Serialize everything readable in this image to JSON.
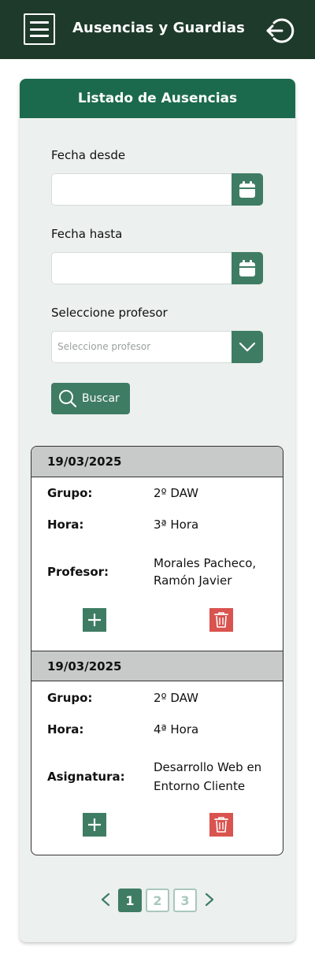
{
  "header": {
    "title": "Ausencias y Guardias",
    "menu_icon": "hamburger-menu-icon",
    "logout_icon": "logout-icon"
  },
  "panel": {
    "title": "Listado de Ausencias",
    "fecha_desde": {
      "label": "Fecha desde",
      "value": ""
    },
    "fecha_hasta": {
      "label": "Fecha hasta",
      "value": ""
    },
    "profesor": {
      "label": "Seleccione profesor",
      "placeholder": "Seleccione profesor"
    },
    "search_label": "Buscar"
  },
  "records": [
    {
      "date": "19/03/2025",
      "grupo_label": "Grupo:",
      "grupo": "2º DAW",
      "hora_label": "Hora:",
      "hora": "3ª Hora",
      "extra_label": "Profesor:",
      "extra_line1": "Morales Pacheco,",
      "extra_line2": "Ramón Javier"
    },
    {
      "date": "19/03/2025",
      "grupo_label": "Grupo:",
      "grupo": "2º DAW",
      "hora_label": "Hora:",
      "hora": "4ª Hora",
      "extra_label": "Asignatura:",
      "extra_line1": "Desarrollo Web en",
      "extra_line2": "Entorno Cliente"
    }
  ],
  "pagination": {
    "pages": [
      "1",
      "2",
      "3"
    ],
    "current": "1"
  },
  "colors": {
    "topbar": "#1e3a2a",
    "panel_header": "#1c6a4e",
    "accent": "#3f7c64",
    "delete": "#d9534f"
  }
}
